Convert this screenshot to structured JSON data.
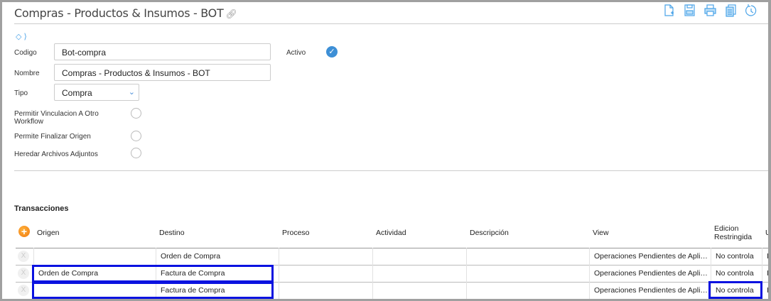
{
  "header": {
    "title": "Compras - Productos & Insumos - BOT",
    "icons": [
      "new-doc-icon",
      "save-icon",
      "print-icon",
      "copy-icon",
      "history-icon"
    ]
  },
  "form": {
    "codigo_label": "Codigo",
    "codigo_value": "Bot-compra",
    "nombre_label": "Nombre",
    "nombre_value": "Compras - Productos & Insumos - BOT",
    "tipo_label": "Tipo",
    "tipo_value": "Compra",
    "activo_label": "Activo",
    "activo_checked": true,
    "permitir_vinculacion_label": "Permitir Vinculacion A Otro Workflow",
    "permite_finalizar_label": "Permite Finalizar Origen",
    "heredar_archivos_label": "Heredar Archivos Adjuntos"
  },
  "transacciones": {
    "title": "Transacciones",
    "columns": [
      "Origen",
      "Destino",
      "Proceso",
      "Actividad",
      "Descripción",
      "View",
      "Edicion Restringida",
      "U"
    ],
    "rows": [
      {
        "origen": "",
        "destino": "Orden de Compra",
        "proceso": "",
        "actividad": "",
        "descripcion": "",
        "view": "Operaciones Pendientes de Apli…",
        "edicion": "No controla",
        "extra": "I"
      },
      {
        "origen": "Orden de Compra",
        "destino": "Factura de Compra",
        "proceso": "",
        "actividad": "",
        "descripcion": "",
        "view": "Operaciones Pendientes de Apli…",
        "edicion": "No controla",
        "extra": "I"
      },
      {
        "origen": "",
        "destino": "Factura de Compra",
        "proceso": "",
        "actividad": "",
        "descripcion": "",
        "view": "Operaciones Pendientes de Apli…",
        "edicion": "No controla",
        "extra": "I"
      }
    ],
    "delete_glyph": "X"
  }
}
